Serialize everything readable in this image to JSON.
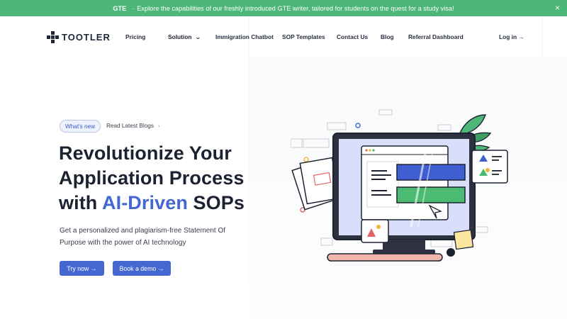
{
  "announcement": {
    "tag": "GTE",
    "separator": "·",
    "text": "Explore the capabilities of our freshly introduced GTE writer, tailored for students on the quest for a study visa!",
    "close_icon": "×"
  },
  "brand": {
    "name": "TOOTLER"
  },
  "nav": {
    "items": [
      "Pricing",
      "Solution",
      "Immigration Chatbot",
      "SOP Templates",
      "Contact Us",
      "Blog",
      "Referral Dashboard"
    ],
    "login": "Log in →",
    "chevron": "⌄"
  },
  "hero": {
    "pill": "What's new",
    "blog_link": "Read Latest Blogs",
    "blog_arrow": "›",
    "headline_line1": "Revolutionize Your",
    "headline_line2": "Application Process",
    "headline_line3_pre": "with ",
    "headline_line3_accent": "AI-Driven",
    "headline_line3_post": " SOPs",
    "subtext": "Get a personalized and plagiarism-free Statement Of Purpose with the power of AI technology",
    "cta_primary": "Try now →",
    "cta_secondary": "Book a demo →"
  },
  "colors": {
    "banner": "#4cb778",
    "accent": "#4467d1",
    "dark": "#1d2232",
    "green_bar": "#4cbb72",
    "blue_bar": "#3f5fd1"
  }
}
